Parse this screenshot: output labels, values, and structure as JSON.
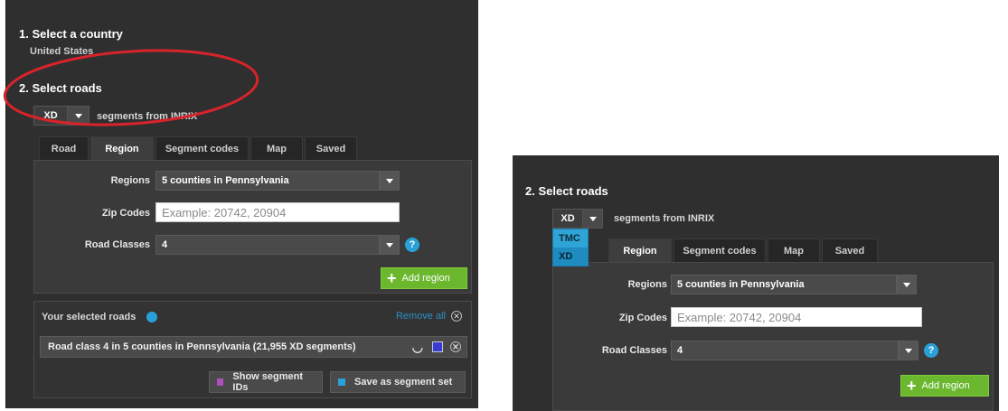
{
  "left": {
    "step1_heading": "1. Select a country",
    "country_value": "United States",
    "step2_heading": "2. Select roads",
    "source_dropdown_value": "XD",
    "source_suffix": "segments from INRIX",
    "tabs": [
      "Road",
      "Region",
      "Segment codes",
      "Map",
      "Saved"
    ],
    "regions_label": "Regions",
    "regions_value": "5 counties in Pennsylvania",
    "zip_label": "Zip Codes",
    "zip_placeholder": "Example: 20742, 20904",
    "road_classes_label": "Road Classes",
    "road_classes_value": "4",
    "help_glyph": "?",
    "add_region_label": "Add region",
    "selected_roads_label": "Your selected roads",
    "remove_all_label": "Remove all",
    "selected_road_text": "Road class 4 in 5 counties in Pennsylvania (21,955 XD segments)",
    "show_ids_label": "Show segment IDs",
    "save_set_label": "Save as segment set"
  },
  "right": {
    "step2_heading": "2. Select roads",
    "source_dropdown_value": "XD",
    "source_suffix": "segments from INRIX",
    "menu_options": [
      "TMC",
      "XD"
    ],
    "tabs": [
      "Region",
      "Segment codes",
      "Map",
      "Saved"
    ],
    "regions_label": "Regions",
    "regions_value": "5 counties in Pennsylvania",
    "zip_label": "Zip Codes",
    "zip_placeholder": "Example: 20742, 20904",
    "road_classes_label": "Road Classes",
    "road_classes_value": "4",
    "help_glyph": "?",
    "add_region_label": "Add region"
  },
  "colors": {
    "panel_bg": "#2f2f2f",
    "accent_green": "#6bb82f",
    "accent_blue": "#2aa0d8",
    "annotation_red": "#d8232a",
    "remove_all_link": "#2b8fc6"
  }
}
